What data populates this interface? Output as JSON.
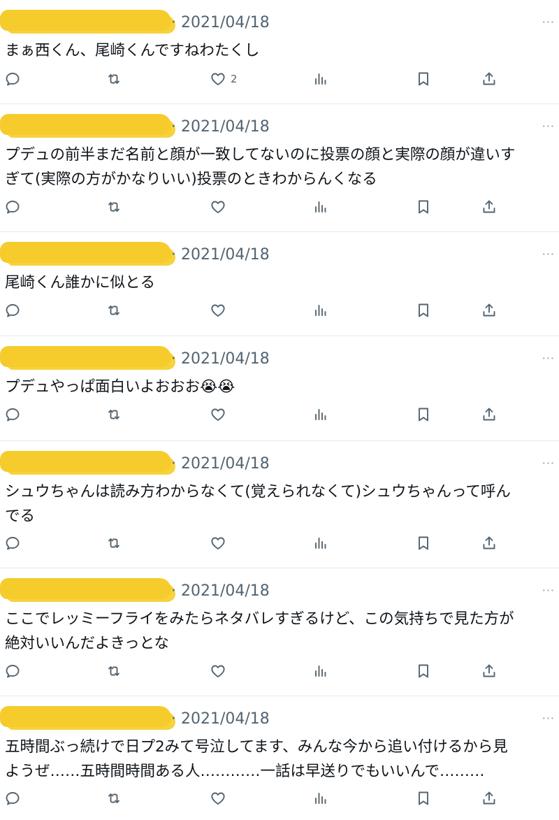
{
  "tweets": [
    {
      "date": "· 2021/04/18",
      "text": "まぁ西くん、尾崎くんですねわたくし",
      "likes": "2"
    },
    {
      "date": "· 2021/04/18",
      "text": "プデュの前半まだ名前と顔が一致してないのに投票の顔と実際の顔が違いす\nぎて(実際の方がかなりいい)投票のときわからんくなる",
      "likes": ""
    },
    {
      "date": "· 2021/04/18",
      "text": "尾崎くん誰かに似とる",
      "likes": ""
    },
    {
      "date": "· 2021/04/18",
      "text": "プデュやっぱ面白いよおおお😭😭",
      "likes": ""
    },
    {
      "date": "· 2021/04/18",
      "text": "シュウちゃんは読み方わからなくて(覚えられなくて)シュウちゃんって呼ん\nでる",
      "likes": ""
    },
    {
      "date": "· 2021/04/18",
      "text": "ここでレッミーフライをみたらネタバレすぎるけど、この気持ちで見た方が\n絶対いいんだよきっとな",
      "likes": ""
    },
    {
      "date": "· 2021/04/18",
      "text": "五時間ぶっ続けで日プ2みて号泣してます、みんな今から追い付けるから見\nようぜ……五時間時間ある人…………一話は早送りでもいいんで………",
      "likes": ""
    }
  ],
  "more_glyph": "···",
  "icons": [
    "reply-icon",
    "retweet-icon",
    "like-icon",
    "views-icon",
    "bookmark-icon",
    "share-icon"
  ]
}
